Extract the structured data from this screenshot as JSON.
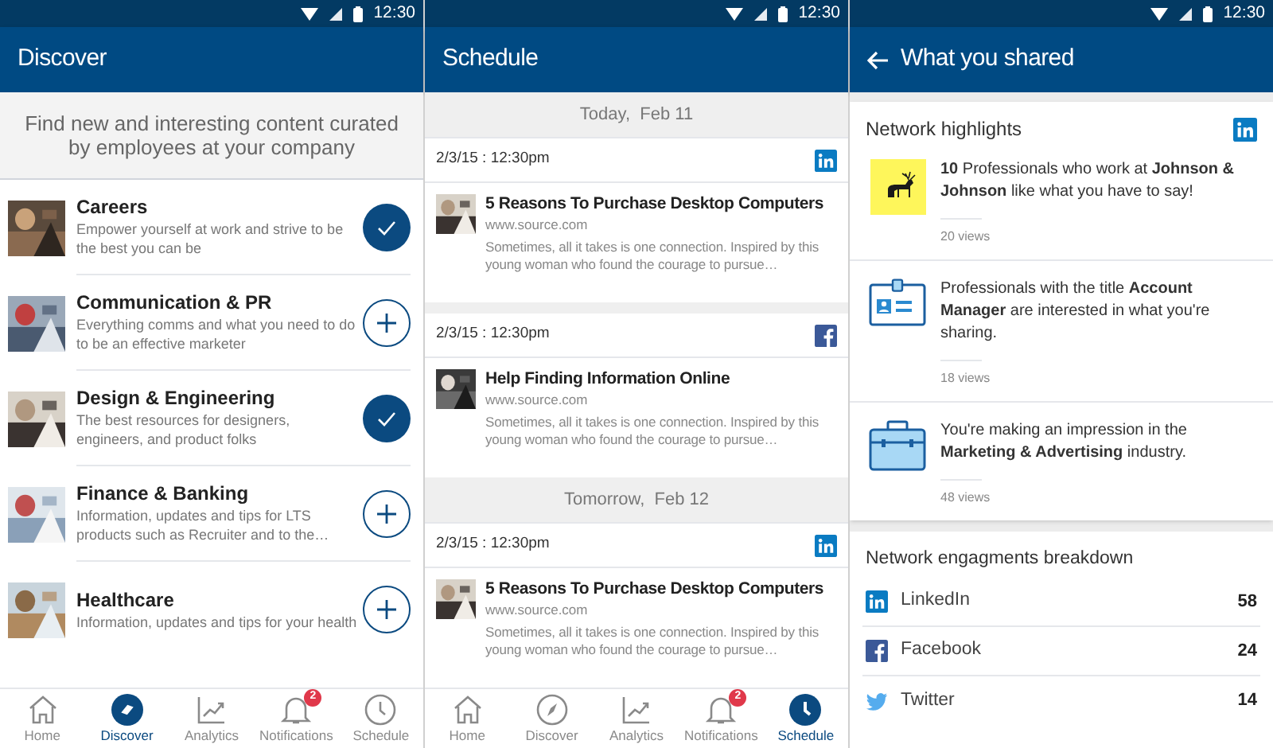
{
  "screens": [
    {
      "kind": "discover",
      "time": "12:30",
      "title": "Discover",
      "intro": "Find new and interesting content curated by employees at your company",
      "topics": [
        {
          "title": "Careers",
          "description": "Empower yourself at work and strive to be the best you can be",
          "followed": true
        },
        {
          "title": "Communication & PR",
          "description": "Everything comms and what you need to do to be an effective marketer",
          "followed": false
        },
        {
          "title": "Design & Engineering",
          "description": "The best resources for designers, engineers, and product folks",
          "followed": true
        },
        {
          "title": "Finance & Banking",
          "description": "Information, updates and tips for LTS products such as Recruiter and to the…",
          "followed": false
        },
        {
          "title": "Healthcare",
          "description": "Information, updates and tips for your health",
          "followed": false
        }
      ],
      "nav": [
        {
          "kind": "home",
          "label": "Home",
          "selected": false
        },
        {
          "kind": "discover",
          "label": "Discover",
          "selected": true
        },
        {
          "kind": "analytics",
          "label": "Analytics",
          "selected": false
        },
        {
          "kind": "notifications",
          "label": "Notifications",
          "selected": false,
          "badge": "2"
        },
        {
          "kind": "schedule",
          "label": "Schedule",
          "selected": false
        }
      ]
    },
    {
      "kind": "schedule",
      "time": "12:30",
      "title": "Schedule",
      "days": [
        {
          "label": "Today,  Feb 11",
          "posts": [
            {
              "when": "2/3/15 : 12:30pm",
              "kind": "linkedin",
              "headline": "5 Reasons To Purchase Desktop Computers",
              "url": "www.source.com",
              "snippet": "Sometimes, all it takes is one connection. Inspired by this young woman who found the courage to pursue…"
            },
            {
              "when": "2/3/15 : 12:30pm",
              "kind": "facebook",
              "headline": "Help Finding Information Online",
              "url": "www.source.com",
              "snippet": "Sometimes, all it takes is one connection. Inspired by this young woman who found the courage to pursue…"
            }
          ]
        },
        {
          "label": "Tomorrow,  Feb 12",
          "posts": [
            {
              "when": "2/3/15 : 12:30pm",
              "kind": "linkedin",
              "headline": "5 Reasons To Purchase Desktop Computers",
              "url": "www.source.com",
              "snippet": "Sometimes, all it takes is one connection. Inspired by this young woman who found the courage to pursue…"
            }
          ]
        }
      ],
      "nav": [
        {
          "kind": "home",
          "label": "Home",
          "selected": false
        },
        {
          "kind": "discover",
          "label": "Discover",
          "selected": false
        },
        {
          "kind": "analytics",
          "label": "Analytics",
          "selected": false
        },
        {
          "kind": "notifications",
          "label": "Notifications",
          "selected": false,
          "badge": "2"
        },
        {
          "kind": "schedule",
          "label": "Schedule",
          "selected": true
        }
      ]
    },
    {
      "kind": "shared",
      "time": "12:30",
      "title": "What you shared",
      "highlights_title": "Network highlights",
      "highlights": [
        {
          "kind": "logo",
          "text": "**10** Professionals who work at **Johnson & Johnson** like what you have to say!",
          "views": "20 views"
        },
        {
          "kind": "badge",
          "text": "Professionals with the title **Account Manager** are interested in what you're sharing.",
          "views": "18 views"
        },
        {
          "kind": "briefcase",
          "text": "You're making an impression in the **Marketing & Advertising** industry.",
          "views": "48 views"
        }
      ],
      "breakdown_title": "Network engagments breakdown",
      "breakdown": [
        {
          "kind": "linkedin",
          "name": "LinkedIn",
          "count": "58"
        },
        {
          "kind": "facebook",
          "name": "Facebook",
          "count": "24"
        },
        {
          "kind": "twitter",
          "name": "Twitter",
          "count": "14"
        }
      ]
    }
  ]
}
